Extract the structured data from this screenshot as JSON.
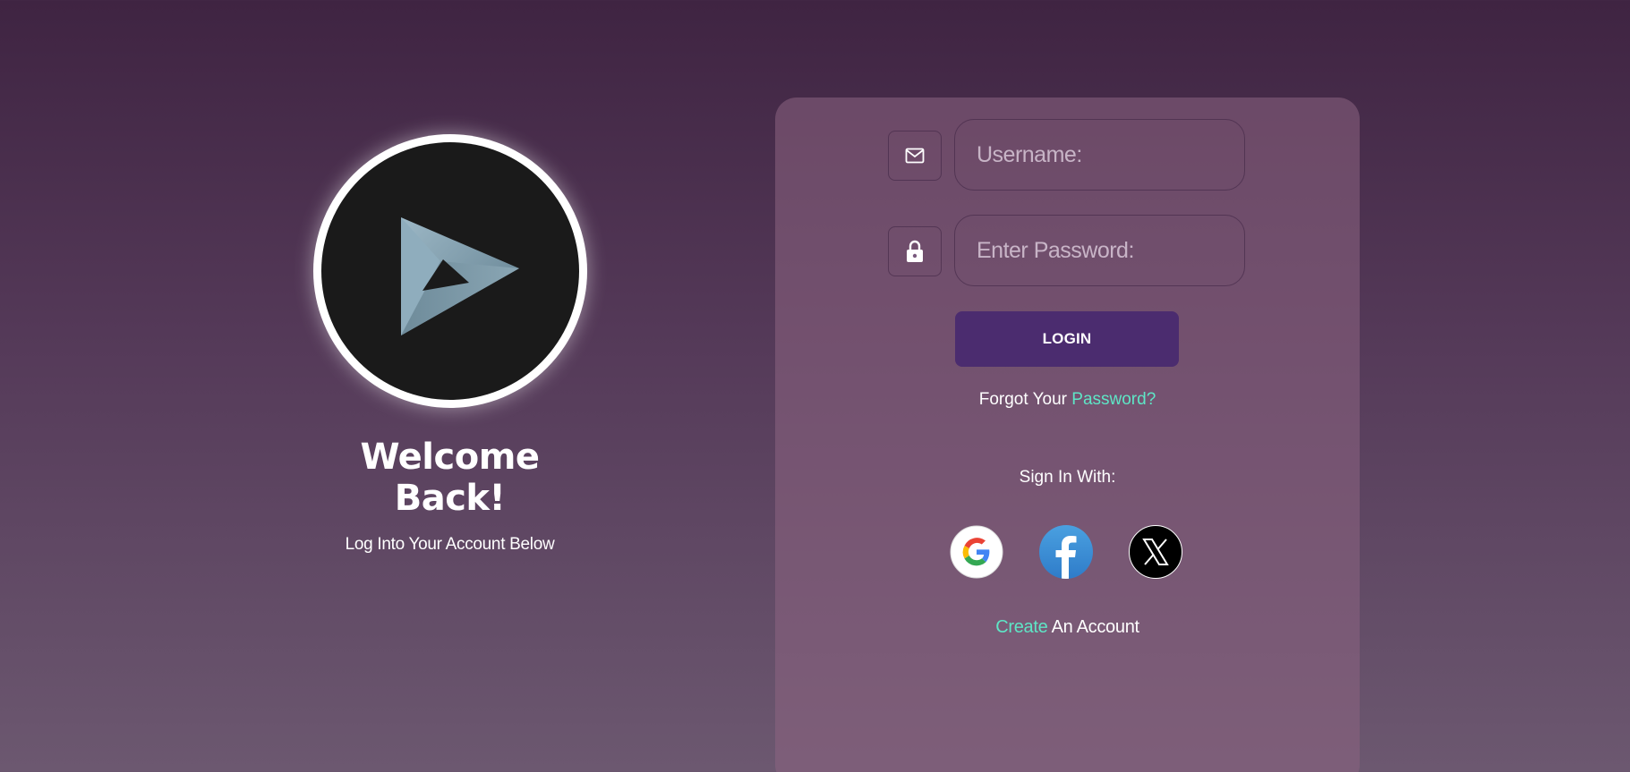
{
  "welcome": {
    "title": "Welcome Back!",
    "subtitle": "Log Into Your Account Below",
    "logo_icon": "play-triangle-logo"
  },
  "form": {
    "username_placeholder": "Username:",
    "username_value": "",
    "username_icon": "mail-icon",
    "password_placeholder": "Enter Password:",
    "password_value": "",
    "password_icon": "lock-icon",
    "login_label": "LOGIN",
    "forgot_prefix": "Forgot Your",
    "forgot_link": "Password?"
  },
  "social": {
    "heading": "Sign In With:",
    "providers": [
      "Google",
      "Facebook",
      "X"
    ]
  },
  "create": {
    "link": "Create",
    "suffix": "An Account"
  },
  "colors": {
    "accent": "#5ee6c6",
    "button": "#4b2c6f",
    "background_top": "#3f2442",
    "background_bottom": "#6c5870"
  }
}
